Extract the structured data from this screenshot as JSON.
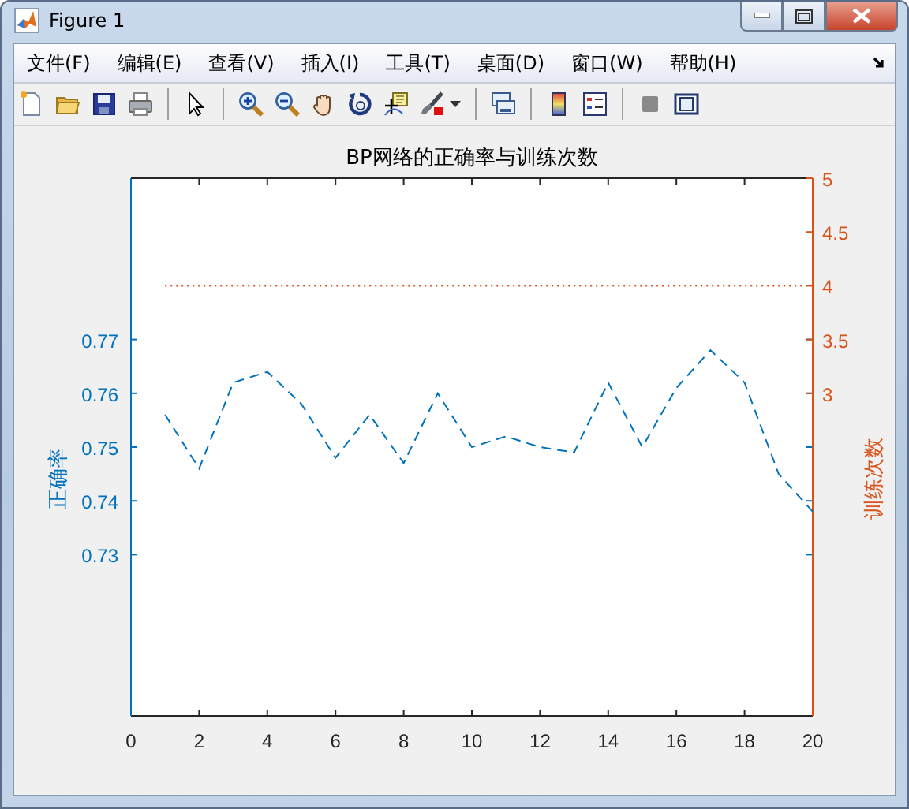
{
  "window": {
    "title": "Figure 1"
  },
  "menu": [
    "文件(F)",
    "编辑(E)",
    "查看(V)",
    "插入(I)",
    "工具(T)",
    "桌面(D)",
    "窗口(W)",
    "帮助(H)"
  ],
  "figure": {
    "chart_data": {
      "type": "line",
      "title": "BP网络的正确率与训练次数",
      "ylabel": "正确率",
      "y2label": "训练次数",
      "x": [
        1,
        2,
        3,
        4,
        5,
        6,
        7,
        8,
        9,
        10,
        11,
        12,
        13,
        14,
        15,
        16,
        17,
        18,
        19,
        20
      ],
      "xlim": [
        0,
        20
      ],
      "xticks": [
        0,
        2,
        4,
        6,
        8,
        10,
        12,
        14,
        16,
        18,
        20
      ],
      "ylim": [
        0.7,
        0.8
      ],
      "yticks": [
        0.73,
        0.74,
        0.75,
        0.76,
        0.77
      ],
      "y2lim": [
        0,
        5
      ],
      "y2ticks": [
        3,
        3.5,
        4,
        4.5,
        5
      ],
      "series": [
        {
          "color": "#0072bd",
          "line_style": "dashed",
          "values": [
            0.756,
            0.746,
            0.762,
            0.764,
            0.758,
            0.748,
            0.756,
            0.747,
            0.76,
            0.75,
            0.752,
            0.75,
            0.749,
            0.762,
            0.75,
            0.761,
            0.768,
            0.762,
            0.745,
            0.738
          ]
        },
        {
          "color": "#d95319",
          "axis": "y2",
          "line_style": "dotted",
          "values": [
            4,
            4,
            4,
            4,
            4,
            4,
            4,
            4,
            4,
            4,
            4,
            4,
            4,
            4,
            4,
            4,
            4,
            4,
            4,
            4
          ]
        }
      ]
    }
  }
}
